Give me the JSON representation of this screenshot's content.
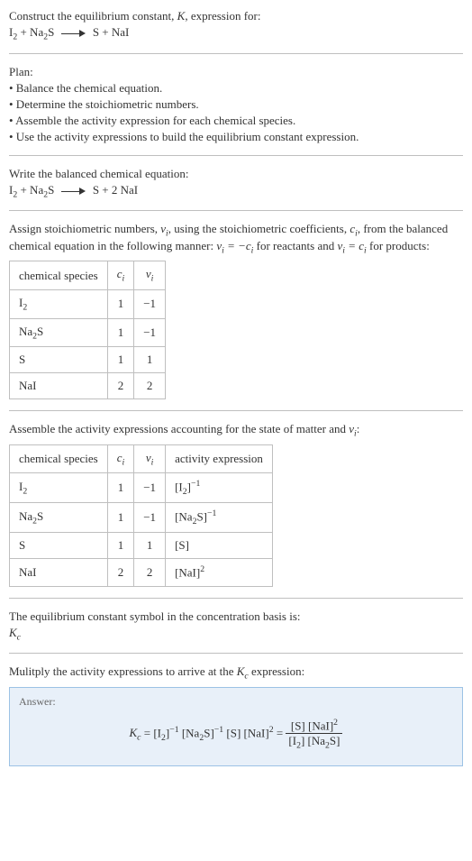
{
  "intro": {
    "line1_pre": "Construct the equilibrium constant, ",
    "line1_post": ", expression for:"
  },
  "plan": {
    "title": "Plan:",
    "b1": "• Balance the chemical equation.",
    "b2": "• Determine the stoichiometric numbers.",
    "b3": "• Assemble the activity expression for each chemical species.",
    "b4": "• Use the activity expressions to build the equilibrium constant expression."
  },
  "balance": {
    "title": "Write the balanced chemical equation:"
  },
  "assign": {
    "pre": "Assign stoichiometric numbers, ",
    "mid1": ", using the stoichiometric coefficients, ",
    "mid2": ", from the balanced chemical equation in the following manner: ",
    "mid3": " for reactants and ",
    "mid4": " for products:"
  },
  "table1": {
    "h1": "chemical species",
    "r1": {
      "c": "1",
      "v": "−1"
    },
    "r2": {
      "c": "1",
      "v": "−1"
    },
    "r3": {
      "c": "1",
      "v": "1"
    },
    "r4": {
      "c": "2",
      "v": "2"
    }
  },
  "assemble": {
    "pre": "Assemble the activity expressions accounting for the state of matter and ",
    "post": ":"
  },
  "table2": {
    "h1": "chemical species",
    "h4": "activity expression",
    "r1": {
      "c": "1",
      "v": "−1"
    },
    "r2": {
      "c": "1",
      "v": "−1"
    },
    "r3": {
      "c": "1",
      "v": "1",
      "ae": "[S]"
    },
    "r4": {
      "c": "2",
      "v": "2"
    }
  },
  "symbol_line": {
    "text": "The equilibrium constant symbol in the concentration basis is:"
  },
  "multiply": {
    "pre": "Mulitply the activity expressions to arrive at the ",
    "post": " expression:"
  },
  "answer": {
    "label": "Answer:"
  },
  "chart_data": {
    "type": "table",
    "tables": [
      {
        "title": "Stoichiometric numbers",
        "columns": [
          "chemical species",
          "c_i",
          "ν_i"
        ],
        "rows": [
          [
            "I2",
            1,
            -1
          ],
          [
            "Na2S",
            1,
            -1
          ],
          [
            "S",
            1,
            1
          ],
          [
            "NaI",
            2,
            2
          ]
        ]
      },
      {
        "title": "Activity expressions",
        "columns": [
          "chemical species",
          "c_i",
          "ν_i",
          "activity expression"
        ],
        "rows": [
          [
            "I2",
            1,
            -1,
            "[I2]^-1"
          ],
          [
            "Na2S",
            1,
            -1,
            "[Na2S]^-1"
          ],
          [
            "S",
            1,
            1,
            "[S]"
          ],
          [
            "NaI",
            2,
            2,
            "[NaI]^2"
          ]
        ]
      }
    ],
    "equations": {
      "unbalanced": "I2 + Na2S -> S + NaI",
      "balanced": "I2 + Na2S -> S + 2 NaI",
      "Kc": "K_c = [I2]^-1 [Na2S]^-1 [S] [NaI]^2 = ([S] [NaI]^2) / ([I2] [Na2S])"
    }
  }
}
